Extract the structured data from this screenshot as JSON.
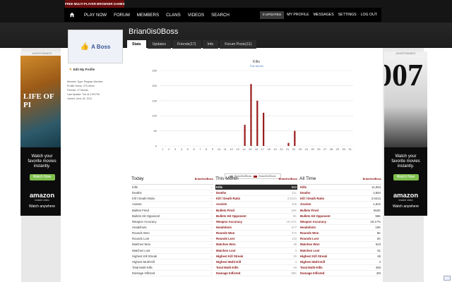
{
  "site": {
    "brand": "FREE MULTI-PLAYER BROWSER GAMES"
  },
  "nav": {
    "items": [
      "PLAY NOW",
      "FORUM",
      "MEMBERS",
      "CLANS",
      "VIDEOS",
      "SEARCH"
    ],
    "updates": "0 UPDATES",
    "right": [
      "MY PROFILE",
      "MESSAGES",
      "SETTINGS",
      "LOG OUT"
    ]
  },
  "profile": {
    "username": "Brian0is0Boss",
    "avatar_text": "A Boss",
    "edit_label": "Edit My Profile",
    "info": [
      "Member Type: Regular Member",
      "Profile Views: 275 views",
      "Friends: 17 friends",
      "Last Update: Tue at 1:59 PM",
      "Joined: June 18, 2012"
    ]
  },
  "tabs": [
    "Stats",
    "Updates",
    "Friends(17)",
    "Info",
    "Forum Posts(11)"
  ],
  "ads": {
    "label": "ADVERTISEMENT",
    "left": {
      "title": "LIFE OF PI",
      "line1": "Watch your",
      "line2": "favorite movies",
      "line3": "instantly.",
      "button": "Watch Now",
      "brand": "amazon",
      "brand_sub": "instant video",
      "tagline": "Watch anywhere"
    },
    "right": {
      "title": "007",
      "line1": "Watch your",
      "line2": "favorite movies",
      "line3": "instantly.",
      "button": "Watch Now",
      "brand": "amazon",
      "brand_sub": "instant video",
      "tagline": "Watch anywhere"
    }
  },
  "chart_data": {
    "type": "bar",
    "title": "Kills",
    "subtitle": "This Month",
    "x": [
      1,
      2,
      3,
      4,
      5,
      6,
      7,
      8,
      9,
      10,
      11,
      12,
      13,
      14,
      15,
      16,
      17,
      18,
      19,
      20,
      21,
      22,
      23,
      24,
      25,
      26,
      27,
      28,
      29,
      30,
      31
    ],
    "ylim": [
      0,
      250
    ],
    "yticks": [
      0,
      50,
      100,
      150,
      200,
      250
    ],
    "grid": true,
    "legend_position": "bottom-center",
    "series": [
      {
        "name": "Brian0is0Boss",
        "color": "#8f8f8f",
        "values": [
          0,
          0,
          0,
          0,
          0,
          0,
          0,
          0,
          0,
          0,
          0,
          0,
          0,
          0,
          0,
          0,
          0,
          0,
          0,
          0,
          0,
          0,
          0,
          0,
          0,
          0,
          0,
          0,
          0,
          0,
          0
        ]
      },
      {
        "name": "Brian0is0Boss",
        "color": "#9a1a1a",
        "values": [
          0,
          0,
          0,
          0,
          0,
          0,
          0,
          0,
          0,
          0,
          0,
          0,
          0,
          70,
          205,
          150,
          110,
          0,
          0,
          0,
          10,
          50,
          0,
          0,
          0,
          0,
          0,
          0,
          0,
          0,
          0
        ]
      }
    ]
  },
  "stats": {
    "today": {
      "title": "Today",
      "user": "Brian0is0Boss",
      "rows": [
        {
          "label": "Kills",
          "value": "--"
        },
        {
          "label": "Deaths",
          "value": "--"
        },
        {
          "label": "Kill / Death Ratio",
          "value": "--"
        },
        {
          "label": "Assists",
          "value": "--"
        },
        {
          "label": "Bullets Fired",
          "value": "--"
        },
        {
          "label": "Bullets Hit Opponent",
          "value": "--"
        },
        {
          "label": "Weapon Accuracy",
          "value": "--"
        },
        {
          "label": "Headshots",
          "value": "--"
        },
        {
          "label": "Rounds Won",
          "value": "--"
        },
        {
          "label": "Rounds Lost",
          "value": "--"
        },
        {
          "label": "Matches Won",
          "value": "--"
        },
        {
          "label": "Matches Lost",
          "value": "--"
        },
        {
          "label": "Highest Kill Streak",
          "value": "--"
        },
        {
          "label": "Highest Multi-Kill",
          "value": "--"
        },
        {
          "label": "Total Multi-Kills",
          "value": "--"
        },
        {
          "label": "Damage Inflicted",
          "value": "--"
        }
      ]
    },
    "month": {
      "title": "This Month",
      "user": "Brian0is0Boss",
      "rows": [
        {
          "label": "Kills",
          "value": "593"
        },
        {
          "label": "Deaths",
          "value": "211"
        },
        {
          "label": "Kill / Death Ratio",
          "value": "2.8104"
        },
        {
          "label": "Assists",
          "value": "106"
        },
        {
          "label": "Bullets Fired",
          "value": "20K"
        },
        {
          "label": "Bullets Hit Opponent",
          "value": "5K"
        },
        {
          "label": "Weapon Accuracy",
          "value": "16.21%"
        },
        {
          "label": "Headshots",
          "value": "677"
        },
        {
          "label": "Rounds Won",
          "value": "370"
        },
        {
          "label": "Rounds Lost",
          "value": "133"
        },
        {
          "label": "Matches Won",
          "value": "38"
        },
        {
          "label": "Matches Lost",
          "value": "3"
        },
        {
          "label": "Highest Kill Streak",
          "value": "30"
        },
        {
          "label": "Highest Multi-Kill",
          "value": "4"
        },
        {
          "label": "Total Multi-Kills",
          "value": "28"
        },
        {
          "label": "Damage Inflicted",
          "value": "85K"
        }
      ]
    },
    "all": {
      "title": "All Time",
      "user": "Brian0is0Boss",
      "rows": [
        {
          "label": "Kills",
          "value": "11,064"
        },
        {
          "label": "Deaths",
          "value": "3,884"
        },
        {
          "label": "Kill / Death Ratio",
          "value": "2.8413"
        },
        {
          "label": "Assists",
          "value": "1,822"
        },
        {
          "label": "Bullets Fired",
          "value": "552K"
        },
        {
          "label": "Bullets Hit Opponent",
          "value": "96K"
        },
        {
          "label": "Weapon Accuracy",
          "value": "18.17%"
        },
        {
          "label": "Headshots",
          "value": "10K"
        },
        {
          "label": "Rounds Won",
          "value": "5K"
        },
        {
          "label": "Rounds Lost",
          "value": "2K"
        },
        {
          "label": "Matches Won",
          "value": "523"
        },
        {
          "label": "Matches Lost",
          "value": "51"
        },
        {
          "label": "Highest Kill Streak",
          "value": "45"
        },
        {
          "label": "Highest Multi-Kill",
          "value": "4"
        },
        {
          "label": "Total Multi-Kills",
          "value": "450"
        },
        {
          "label": "Damage Inflicted",
          "value": "2M"
        }
      ]
    }
  }
}
